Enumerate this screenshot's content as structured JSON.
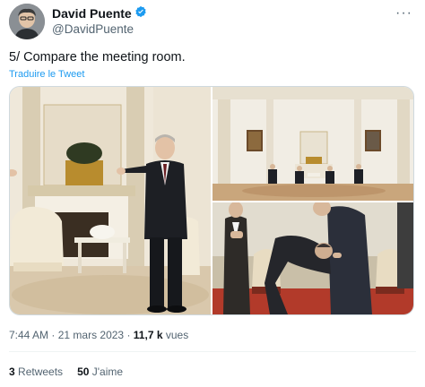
{
  "author": {
    "display_name": "David Puente",
    "handle": "@DavidPuente",
    "verified_icon": "verified-badge-icon",
    "avatar_icon": "avatar"
  },
  "more_icon_label": "···",
  "tweet": {
    "text": "5/ Compare the meeting room.",
    "translate_label": "Traduire le Tweet"
  },
  "media": {
    "images": [
      "photo-meeting-handshake",
      "photo-meeting-room-wide",
      "photo-bowing-guest"
    ]
  },
  "meta": {
    "time": "7:44 AM",
    "separator1": "·",
    "date": "21 mars 2023",
    "separator2": "·",
    "views_count": "11,7 k",
    "views_label": "vues"
  },
  "stats": {
    "retweets_count": "3",
    "retweets_label": "Retweets",
    "likes_count": "50",
    "likes_label": "J'aime"
  },
  "colors": {
    "accent": "#1d9bf0",
    "secondary_text": "#536471",
    "divider": "#eff3f4"
  }
}
